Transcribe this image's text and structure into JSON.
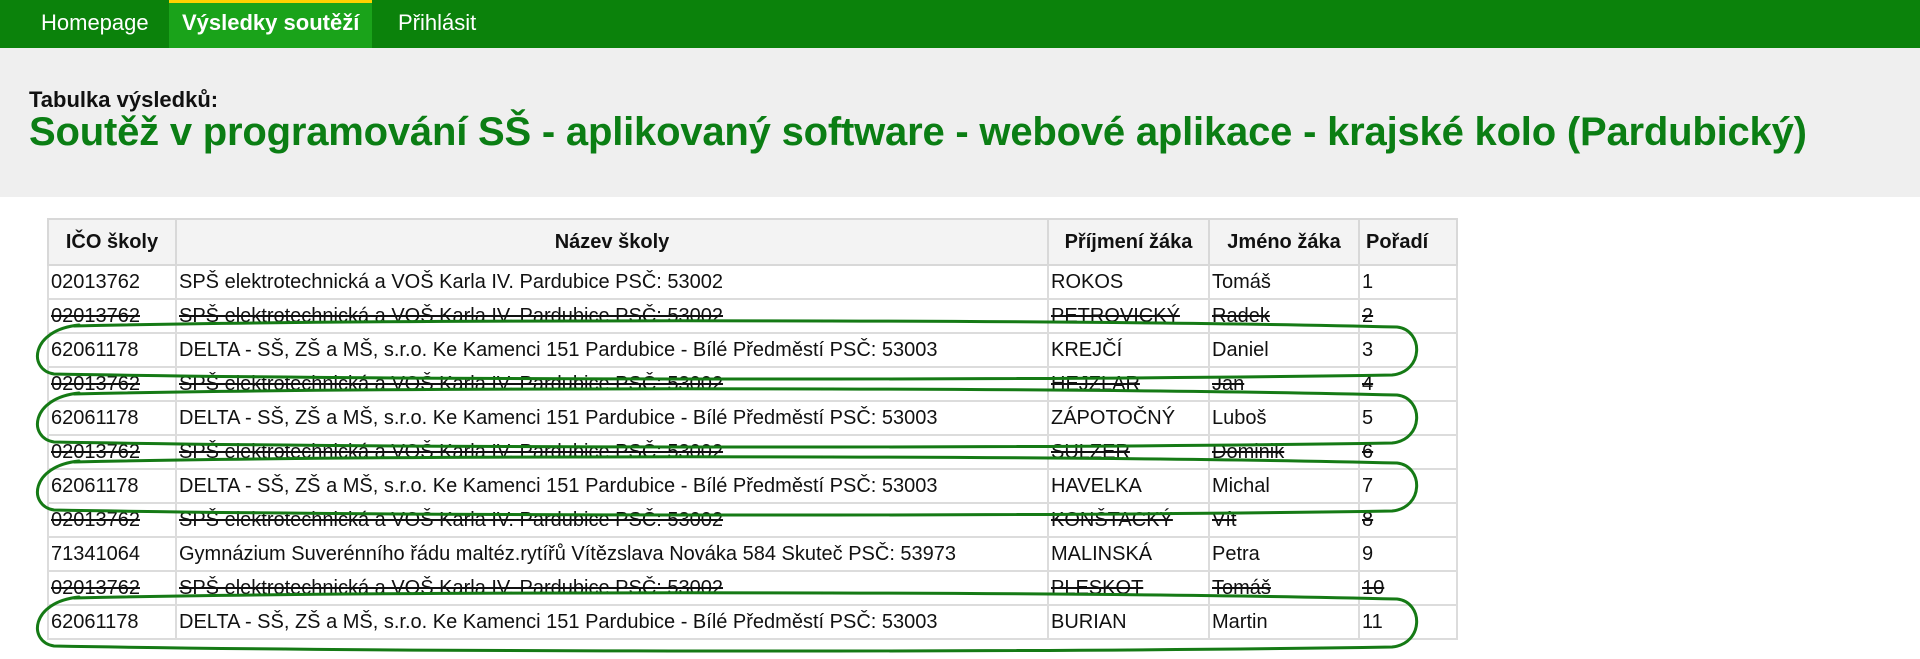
{
  "nav": {
    "items": [
      {
        "label": "Homepage"
      },
      {
        "label": "Výsledky soutěží"
      },
      {
        "label": "Přihlásit"
      }
    ]
  },
  "header": {
    "subtitle": "Tabulka výsledků:",
    "title": "Soutěž v programování SŠ - aplikovaný software - webové aplikace - krajské kolo (Pardubický)"
  },
  "table": {
    "columns": [
      "IČO školy",
      "Název školy",
      "Příjmení žáka",
      "Jméno žáka",
      "Pořadí"
    ],
    "rows": [
      {
        "ico": "02013762",
        "nazev": "SPŠ elektrotechnická a VOŠ Karla IV. Pardubice PSČ: 53002",
        "prijmeni": "ROKOS",
        "jmeno": "Tomáš",
        "poradi": "1",
        "struck": false,
        "circled": false
      },
      {
        "ico": "02013762",
        "nazev": "SPŠ elektrotechnická a VOŠ Karla IV. Pardubice PSČ: 53002",
        "prijmeni": "PETROVICKÝ",
        "jmeno": "Radek",
        "poradi": "2",
        "struck": true,
        "circled": false
      },
      {
        "ico": "62061178",
        "nazev": "DELTA - SŠ, ZŠ a MŠ, s.r.o. Ke Kamenci 151 Pardubice - Bílé Předměstí PSČ: 53003",
        "prijmeni": "KREJČÍ",
        "jmeno": "Daniel",
        "poradi": "3",
        "struck": false,
        "circled": true
      },
      {
        "ico": "02013762",
        "nazev": "SPŠ elektrotechnická a VOŠ Karla IV. Pardubice PSČ: 53002",
        "prijmeni": "HEJZLAR",
        "jmeno": "Jan",
        "poradi": "4",
        "struck": true,
        "circled": false
      },
      {
        "ico": "62061178",
        "nazev": "DELTA - SŠ, ZŠ a MŠ, s.r.o. Ke Kamenci 151 Pardubice - Bílé Předměstí PSČ: 53003",
        "prijmeni": "ZÁPOTOČNÝ",
        "jmeno": "Luboš",
        "poradi": "5",
        "struck": false,
        "circled": true
      },
      {
        "ico": "02013762",
        "nazev": "SPŠ elektrotechnická a VOŠ Karla IV. Pardubice PSČ: 53002",
        "prijmeni": "SULZER",
        "jmeno": "Dominik",
        "poradi": "6",
        "struck": true,
        "circled": false
      },
      {
        "ico": "62061178",
        "nazev": "DELTA - SŠ, ZŠ a MŠ, s.r.o. Ke Kamenci 151 Pardubice - Bílé Předměstí PSČ: 53003",
        "prijmeni": "HAVELKA",
        "jmeno": "Michal",
        "poradi": "7",
        "struck": false,
        "circled": true
      },
      {
        "ico": "02013762",
        "nazev": "SPŠ elektrotechnická a VOŠ Karla IV. Pardubice PSČ: 53002",
        "prijmeni": "KONŠTACKÝ",
        "jmeno": "Vít",
        "poradi": "8",
        "struck": true,
        "circled": false
      },
      {
        "ico": "71341064",
        "nazev": "Gymnázium Suverénního řádu maltéz.rytířů Vítězslava Nováka 584 Skuteč PSČ: 53973",
        "prijmeni": "MALINSKÁ",
        "jmeno": "Petra",
        "poradi": "9",
        "struck": false,
        "circled": false
      },
      {
        "ico": "02013762",
        "nazev": "SPŠ elektrotechnická a VOŠ Karla IV. Pardubice PSČ: 53002",
        "prijmeni": "PLESKOT",
        "jmeno": "Tomáš",
        "poradi": "10",
        "struck": true,
        "circled": false
      },
      {
        "ico": "62061178",
        "nazev": "DELTA - SŠ, ZŠ a MŠ, s.r.o. Ke Kamenci 151 Pardubice - Bílé Předměstí PSČ: 53003",
        "prijmeni": "BURIAN",
        "jmeno": "Martin",
        "poradi": "11",
        "struck": false,
        "circled": true
      }
    ]
  },
  "colors": {
    "nav_bg": "#0b820b",
    "nav_active_bg": "#1aa31a",
    "nav_active_border": "#ffd200",
    "title": "#0b7e14",
    "annotation": "#157a15"
  }
}
